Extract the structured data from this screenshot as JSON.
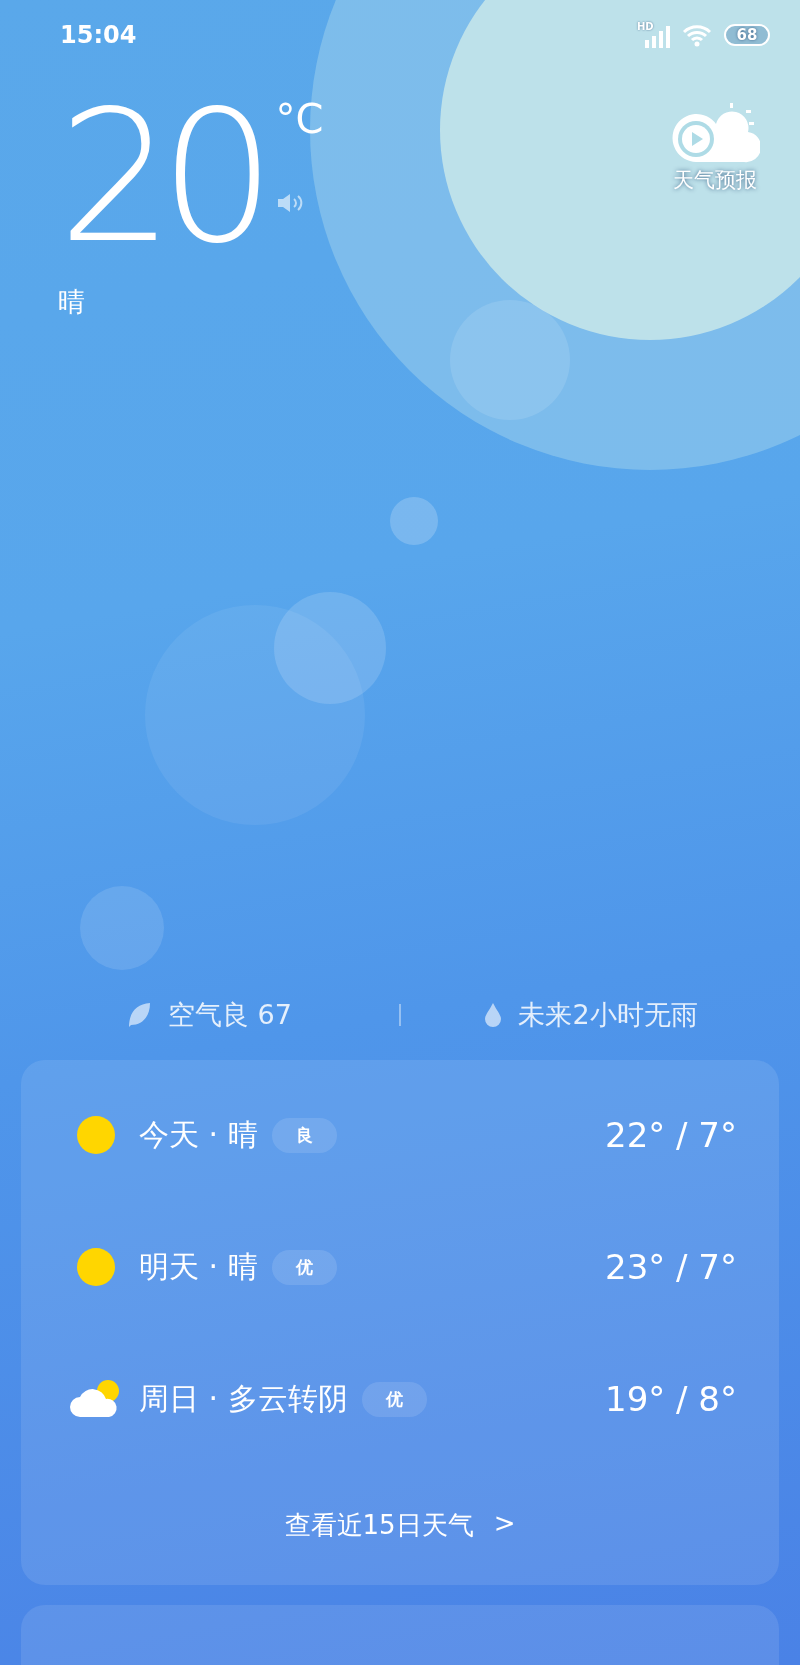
{
  "status_bar": {
    "time": "15:04",
    "network": "HD",
    "battery": "68"
  },
  "current": {
    "temperature": "20",
    "unit": "°C",
    "condition": "晴"
  },
  "forecast_button": {
    "label": "天气预报"
  },
  "summary": {
    "air": "空气良 67",
    "rain": "未来2小时无雨"
  },
  "daily": [
    {
      "kind": "sunny",
      "label": "今天 · 晴",
      "aqi": "良",
      "temps": "22° / 7°"
    },
    {
      "kind": "sunny",
      "label": "明天 · 晴",
      "aqi": "优",
      "temps": "23° / 7°"
    },
    {
      "kind": "partly_cloudy",
      "label": "周日 · 多云转阴",
      "aqi": "优",
      "temps": "19° / 8°"
    }
  ],
  "more_link": {
    "label": "查看近15日天气",
    "arrow": ">"
  }
}
